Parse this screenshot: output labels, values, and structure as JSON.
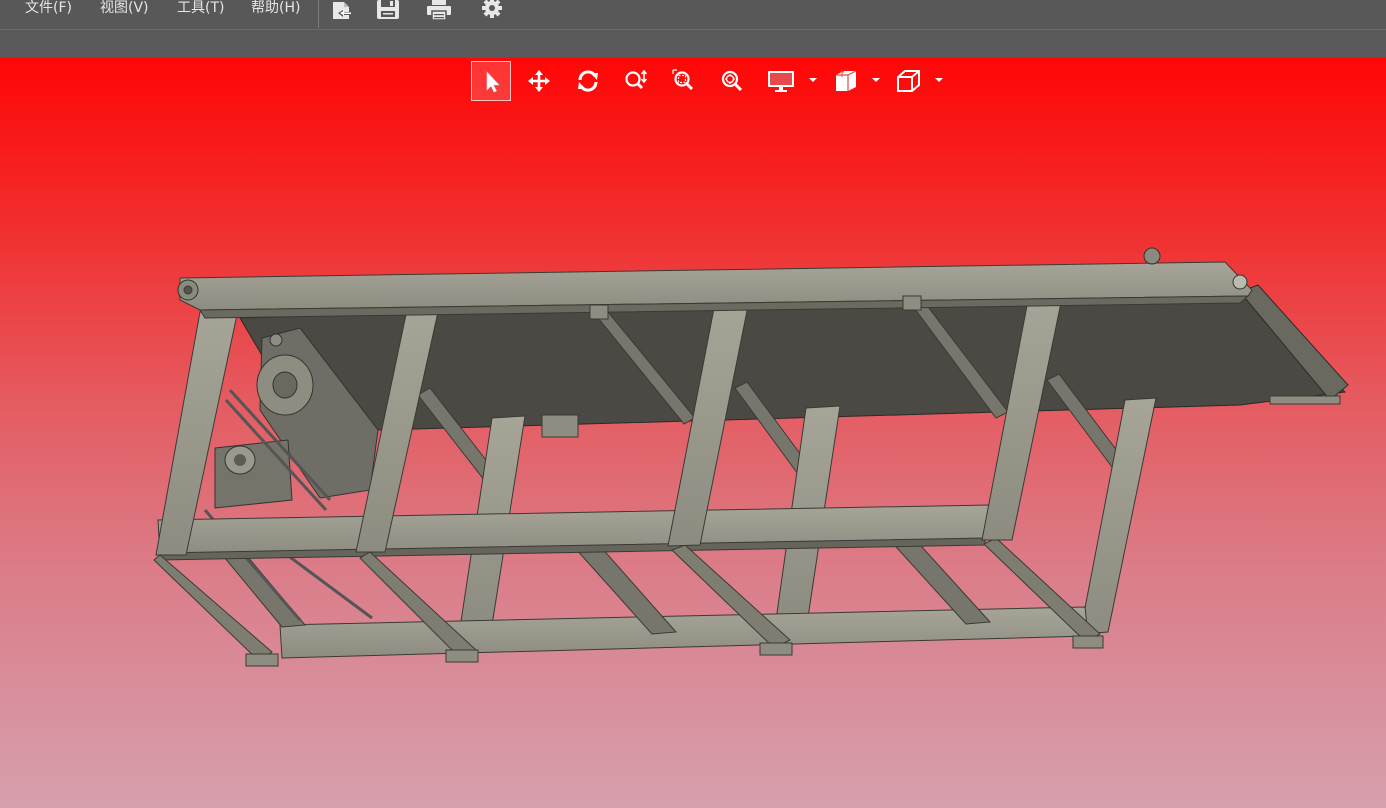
{
  "menu": {
    "file": "文件(F)",
    "view": "视图(V)",
    "tools": "工具(T)",
    "help": "帮助(H)"
  },
  "toolbar": {
    "icons": [
      "open-icon",
      "save-icon",
      "print-icon",
      "settings-icon"
    ]
  },
  "view_toolbar": {
    "icons": [
      "select-icon",
      "pan-icon",
      "rotate-icon",
      "zoom-icon",
      "zoom-window-icon",
      "zoom-fit-icon",
      "display-mode-icon",
      "section-icon",
      "view-orientation-icon"
    ],
    "active": "select-icon"
  },
  "viewport": {
    "background_top": "#ff0606",
    "background_bottom": "#d6a0ad",
    "model_color": "#9a9a8c",
    "belt_color": "#484741"
  }
}
